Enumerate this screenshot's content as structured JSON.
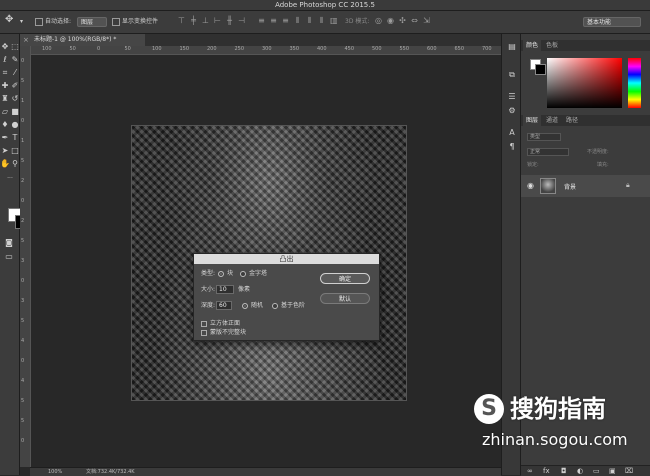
{
  "app": {
    "title": "Adobe Photoshop CC 2015.5"
  },
  "options_bar": {
    "auto_select_label": "自动选择:",
    "auto_select_value": "图层",
    "show_transform_label": "显示变换控件",
    "mode_3d_label": "3D 模式:",
    "workspace_value": "基本功能"
  },
  "document": {
    "tab_label": "未标题-1 @ 100%(RGB/8*) *",
    "close_glyph": "×"
  },
  "rulers": {
    "top_ticks": [
      "100",
      "50",
      "0",
      "50",
      "100",
      "150",
      "200",
      "250",
      "300",
      "350",
      "400",
      "450",
      "500",
      "550",
      "600",
      "650",
      "700"
    ],
    "left_ticks": [
      "0",
      "5",
      "1",
      "0",
      "1",
      "5",
      "2",
      "0",
      "2",
      "5",
      "3",
      "0",
      "3",
      "5",
      "4",
      "0",
      "4",
      "5",
      "5",
      "0"
    ]
  },
  "status": {
    "zoom": "100%",
    "doc_info": "文档:732.4K/732.4K"
  },
  "dialog": {
    "title": "凸出",
    "type_label": "类型:",
    "type_options": [
      "块",
      "金字塔"
    ],
    "type_selected": 0,
    "size_label": "大小:",
    "size_value": "10",
    "size_unit": "像素",
    "depth_label": "深度:",
    "depth_value": "60",
    "depth_options": [
      "随机",
      "基于色阶"
    ],
    "depth_selected": 0,
    "checkbox_cube": "立方体正面",
    "checkbox_mask": "蒙版不完整块",
    "ok_label": "确定",
    "default_label": "默认"
  },
  "panels": {
    "color_tabs": [
      "颜色",
      "色板"
    ],
    "layer_tabs": [
      "图层",
      "通道",
      "路径"
    ],
    "kind_filter": "类型",
    "blend_mode": "正常",
    "opacity_label": "不透明度:",
    "lock_label": "锁定:",
    "fill_label": "填充:",
    "layer_name": "背景"
  },
  "colors": {
    "foreground": "#ffffff",
    "background": "#000000"
  },
  "watermark": {
    "brand": "搜狗指南",
    "url": "zhinan.sogou.com"
  }
}
